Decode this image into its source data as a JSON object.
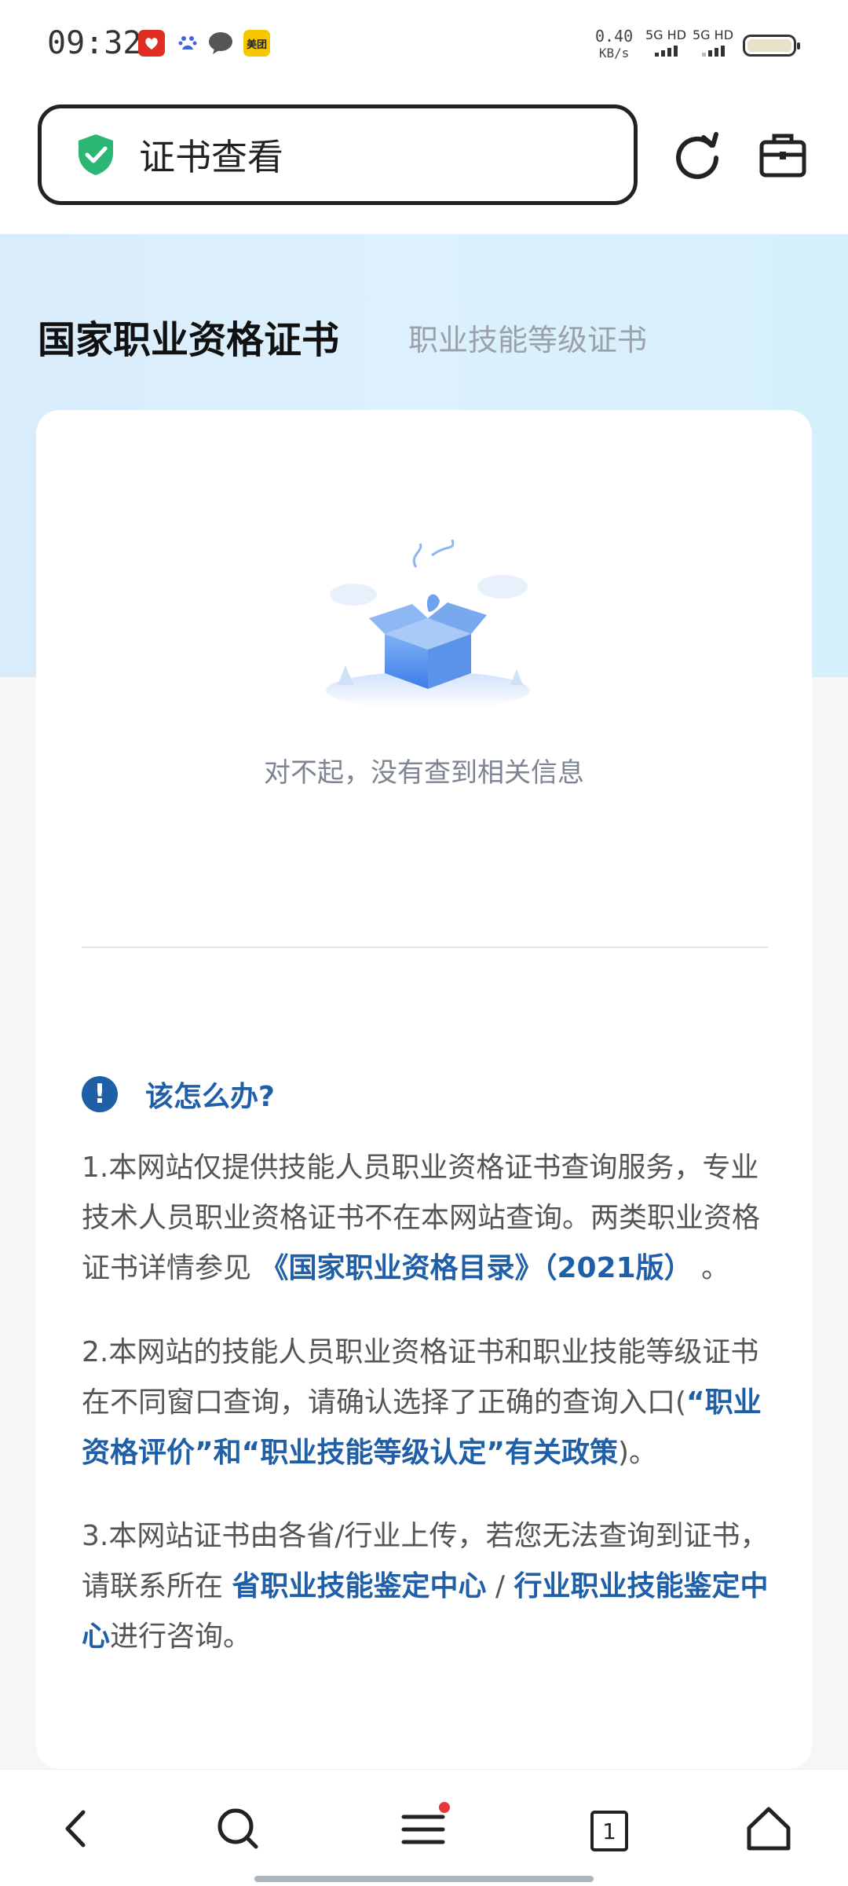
{
  "status_bar": {
    "time": "09:32",
    "net_speed_value": "0.40",
    "net_speed_unit": "KB/s",
    "sim1_label": "5G HD",
    "sim2_label": "5G HD",
    "apps": [
      "pinduoduo-icon",
      "baidu-icon",
      "message-icon",
      "meituan-icon"
    ],
    "meituan_label": "美团"
  },
  "address_bar": {
    "title": "证书查看",
    "secure_icon": "shield-check-icon",
    "reload_icon": "reload-icon",
    "toolbox_icon": "toolbox-icon"
  },
  "tabs": {
    "active": "国家职业资格证书",
    "inactive": "职业技能等级证书"
  },
  "result": {
    "empty_message": "对不起，没有查到相关信息",
    "illustration": "empty-box-illustration"
  },
  "help": {
    "title": "该怎么办?",
    "p1_text": "1.本网站仅提供技能人员职业资格证书查询服务，专业技术人员职业资格证书不在本网站查询。两类职业资格证书详情参见 ",
    "p1_link": "《国家职业资格目录》（2021版）",
    "p1_end": " 。",
    "p2_text": "2.本网站的技能人员职业资格证书和职业技能等级证书在不同窗口查询，请确认选择了正确的查询入口(",
    "p2_link": "“职业资格评价”和“职业技能等级认定”有关政策",
    "p2_end": ")。",
    "p3_text": "3.本网站证书由各省/行业上传，若您无法查询到证书，请联系所在 ",
    "p3_link1": "省职业技能鉴定中心",
    "p3_sep": " / ",
    "p3_link2": "行业职业技能鉴定中心",
    "p3_end": "进行咨询。"
  },
  "bottom_nav": {
    "tab_count": "1",
    "has_menu_notification": true,
    "colors": {
      "notification": "#e53935",
      "accent": "#1f5fa8",
      "secure": "#2bb673"
    }
  }
}
